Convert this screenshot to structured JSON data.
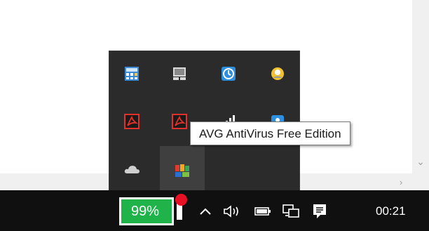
{
  "tooltip": {
    "text": "AVG AntiVirus Free Edition"
  },
  "taskbar": {
    "battery_label": "99%",
    "clock": "00:21"
  },
  "tray_overflow": {
    "icons": [
      "calculator-app-icon",
      "touchpad-icon",
      "update-clock-icon",
      "security-shield-icon",
      "adobe-acrobat-icon",
      "adobe-acrobat-updater-icon",
      "network-meter-icon",
      "messenger-icon",
      "onedrive-cloud-icon",
      "avg-antivirus-icon"
    ]
  },
  "colors": {
    "taskbar_bg": "#101010",
    "flyout_bg": "#2b2b2b",
    "battery_green": "#1fb34a",
    "notification_red": "#e81123"
  }
}
